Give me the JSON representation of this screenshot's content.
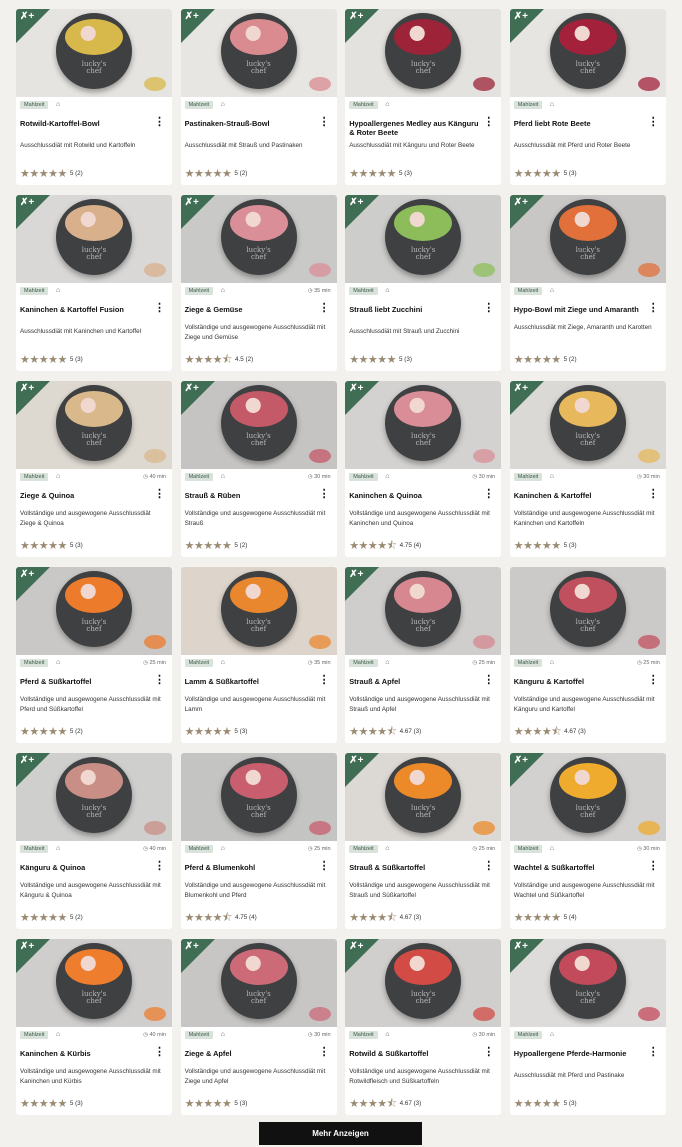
{
  "badge_label": "Mahlzeit",
  "more_button_label": "Mehr Anzeigen",
  "bowl_logo": "lucky's\nchef",
  "colors": {
    "accent_green": "#3f6e54",
    "badge_bg": "#d9e3db",
    "star": "#9b8a72",
    "button_bg": "#111111"
  },
  "products": [
    {
      "title": "Rotwild-Kartoffel-Bowl",
      "desc": "Ausschlussdiät mit Rotwild und Kartoffeln",
      "rating": "5 (2)",
      "stars": 5,
      "time": "",
      "bg": "#e6e4e0",
      "food": "#d7b84a",
      "corner": true
    },
    {
      "title": "Pastinaken-Strauß-Bowl",
      "desc": "Ausschlussdiät mit Strauß und Pastinaken",
      "rating": "5 (2)",
      "stars": 5,
      "time": "",
      "bg": "#e8e6e2",
      "food": "#d98b90",
      "corner": true
    },
    {
      "title": "Hypoallergenes Medley aus Känguru & Roter Beete",
      "desc": "Ausschlussdiät mit Känguru und Roter Beete",
      "rating": "5 (3)",
      "stars": 5,
      "time": "",
      "bg": "#e4e2de",
      "food": "#9c2338",
      "corner": true
    },
    {
      "title": "Pferd liebt Rote Beete",
      "desc": "Ausschlussdiät mit Pferd und Roter Beete",
      "rating": "5 (3)",
      "stars": 5,
      "time": "",
      "bg": "#e7e5e1",
      "food": "#a3213b",
      "corner": true
    },
    {
      "title": "Kaninchen & Kartoffel Fusion",
      "desc": "Ausschlussdiät mit Kaninchen und Kartoffel",
      "rating": "5 (3)",
      "stars": 5,
      "time": "",
      "bg": "#d9d8d6",
      "food": "#d8b08c",
      "corner": true
    },
    {
      "title": "Ziege & Gemüse",
      "desc": "Vollständige und ausgewogene Ausschlussdiät mit Ziege und Gemüse",
      "rating": "4.5 (2)",
      "stars": 4.5,
      "time": "35 min",
      "bg": "#c9c9c8",
      "food": "#d98e98",
      "corner": true
    },
    {
      "title": "Strauß liebt Zucchini",
      "desc": "Ausschlussdiät mit Strauß und Zucchini",
      "rating": "5 (3)",
      "stars": 5,
      "time": "",
      "bg": "#cdcdcc",
      "food": "#8dbd5a",
      "corner": true
    },
    {
      "title": "Hypo-Bowl mit Ziege und Amaranth",
      "desc": "Ausschlussdiät mit Ziege, Amaranth und Karotten",
      "rating": "5 (2)",
      "stars": 5,
      "time": "",
      "bg": "#c8c7c6",
      "food": "#e2703a",
      "corner": true
    },
    {
      "title": "Ziege & Quinoa",
      "desc": "Vollständige und ausgewogene Ausschlussdiät Ziege & Quinoa",
      "rating": "5 (3)",
      "stars": 5,
      "time": "40 min",
      "bg": "#ddd8d0",
      "food": "#d9b88c",
      "corner": true
    },
    {
      "title": "Strauß & Rüben",
      "desc": "Vollständige und ausgewogene Ausschlussdiät mit Strauß",
      "rating": "5 (2)",
      "stars": 5,
      "time": "30 min",
      "bg": "#c5c4c2",
      "food": "#c45968",
      "corner": true
    },
    {
      "title": "Kaninchen & Quinoa",
      "desc": "Vollständige und ausgewogene Ausschlussdiät mit Kaninchen und Quinoa",
      "rating": "4.75 (4)",
      "stars": 4.75,
      "time": "30 min",
      "bg": "#d3d2d0",
      "food": "#d98e97",
      "corner": true
    },
    {
      "title": "Kaninchen & Kartoffel",
      "desc": "Vollständige und ausgewogene Ausschlussdiät mit Kaninchen und Kartoffeln",
      "rating": "5 (3)",
      "stars": 5,
      "time": "30 min",
      "bg": "#dbd9d5",
      "food": "#e7b85c",
      "corner": true
    },
    {
      "title": "Pferd & Süßkartoffel",
      "desc": "Vollständige und ausgewogene Ausschlussdiät mit Pferd und Süßkartoffel",
      "rating": "5 (2)",
      "stars": 5,
      "time": "25 min",
      "bg": "#c9c8c6",
      "food": "#ec7b2c",
      "corner": true
    },
    {
      "title": "Lamm & Süßkartoffel",
      "desc": "Vollständige und ausgewogene Ausschlussdiät mit Lamm",
      "rating": "5 (3)",
      "stars": 5,
      "time": "35 min",
      "bg": "#ddd5cb",
      "food": "#e9872f",
      "corner": false
    },
    {
      "title": "Strauß & Apfel",
      "desc": "Vollständige und ausgewogene Ausschlussdiät mit Strauß und Apfel",
      "rating": "4.67 (3)",
      "stars": 4.67,
      "time": "25 min",
      "bg": "#cfcecd",
      "food": "#d6878f",
      "corner": true
    },
    {
      "title": "Känguru & Kartoffel",
      "desc": "Vollständige und ausgewogene Ausschlussdiät mit Känguru und Kartoffel",
      "rating": "4.67 (3)",
      "stars": 4.67,
      "time": "25 min",
      "bg": "#cbcac9",
      "food": "#c1505e",
      "corner": false
    },
    {
      "title": "Känguru & Quinoa",
      "desc": "Vollständige und ausgewogene Ausschlussdiät mit Känguru & Quinoa",
      "rating": "5 (2)",
      "stars": 5,
      "time": "40 min",
      "bg": "#cfcfce",
      "food": "#c98e86",
      "corner": true
    },
    {
      "title": "Pferd & Blumenkohl",
      "desc": "Vollständige und ausgewogene Ausschlussdiät mit Blumenkohl und Pferd",
      "rating": "4.75 (4)",
      "stars": 4.75,
      "time": "25 min",
      "bg": "#c4c4c3",
      "food": "#c85e6e",
      "corner": false
    },
    {
      "title": "Strauß & Süßkartoffel",
      "desc": "Vollständige und ausgewogene Ausschlussdiät mit Strauß und Süßkartoffel",
      "rating": "4.67 (3)",
      "stars": 4.67,
      "time": "25 min",
      "bg": "#dcd9d4",
      "food": "#ec8a2a",
      "corner": true
    },
    {
      "title": "Wachtel & Süßkartoffel",
      "desc": "Vollständige und ausgewogene Ausschlussdiät mit Wachtel und Süßkartoffel",
      "rating": "5 (4)",
      "stars": 5,
      "time": "30 min",
      "bg": "#d2d1cf",
      "food": "#efab2e",
      "corner": true
    },
    {
      "title": "Kaninchen & Kürbis",
      "desc": "Vollständige und ausgewogene Ausschlussdiät mit Kaninchen und Kürbis",
      "rating": "5 (3)",
      "stars": 5,
      "time": "40 min",
      "bg": "#cfcecd",
      "food": "#ee7d2e",
      "corner": true
    },
    {
      "title": "Ziege & Apfel",
      "desc": "Vollständige und ausgewogene Ausschlussdiät mit Ziege und Apfel",
      "rating": "5 (3)",
      "stars": 5,
      "time": "30 min",
      "bg": "#c7c6c5",
      "food": "#cc6a78",
      "corner": true
    },
    {
      "title": "Rotwild & Süßkartoffel",
      "desc": "Vollständige und ausgewogene Ausschlussdiät mit Rotwildfleisch und Süßkartoffeln",
      "rating": "4.67 (3)",
      "stars": 4.67,
      "time": "30 min",
      "bg": "#d0cfcd",
      "food": "#d24b44",
      "corner": true
    },
    {
      "title": "Hypoallergene Pferde-Harmonie",
      "desc": "Ausschlussdiät mit Pferd und Pastinake",
      "rating": "5 (3)",
      "stars": 5,
      "time": "",
      "bg": "#dddcda",
      "food": "#c24a5a",
      "corner": true
    }
  ]
}
